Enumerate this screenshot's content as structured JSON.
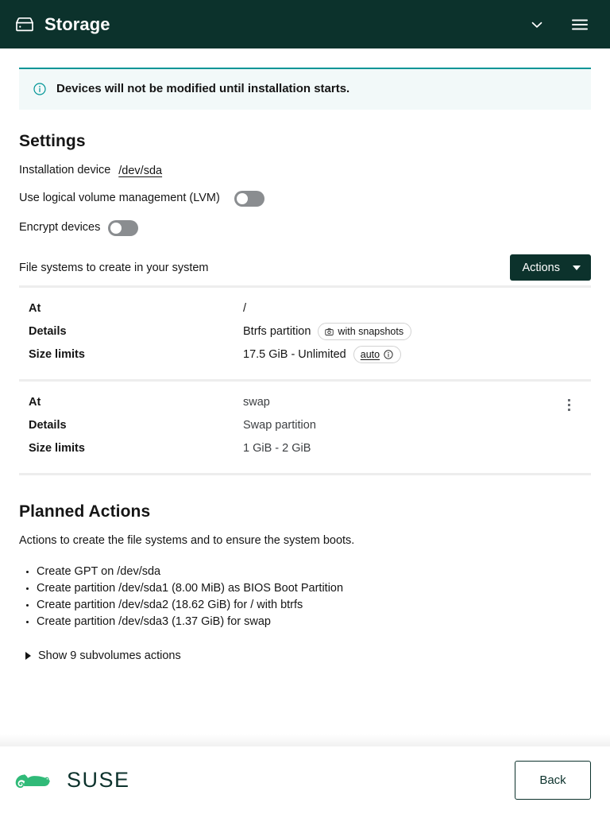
{
  "header": {
    "title": "Storage",
    "storage_icon": "hard-drive-icon",
    "collapse_icon": "chevron-down-icon",
    "menu_icon": "hamburger-menu-icon",
    "bg_color": "#0c322c"
  },
  "alert": {
    "icon": "info-circle-icon",
    "text": "Devices will not be modified until installation starts.",
    "accent_color": "#009596",
    "bg_color": "#f2f9f9"
  },
  "settings": {
    "title": "Settings",
    "installation_device": {
      "label": "Installation device",
      "value": "/dev/sda"
    },
    "lvm": {
      "label": "Use logical volume management (LVM)",
      "state": "off"
    },
    "encrypt": {
      "label": "Encrypt devices",
      "state": "off"
    }
  },
  "filesystems": {
    "caption": "File systems to create in your system",
    "actions_button": {
      "label": "Actions",
      "icon": "caret-down-icon"
    },
    "row_keys": {
      "at": "At",
      "details": "Details",
      "size_limits": "Size limits"
    },
    "rows": [
      {
        "at": "/",
        "details": "Btrfs partition",
        "details_chip": {
          "icon": "camera-snapshot-icon",
          "label": "with snapshots"
        },
        "size_limits": "17.5 GiB - Unlimited",
        "size_chip": {
          "label": "auto",
          "icon": "info-circle-icon"
        },
        "has_kebab": false
      },
      {
        "at": "swap",
        "details": "Swap partition",
        "details_chip": null,
        "size_limits": "1 GiB - 2 GiB",
        "size_chip": null,
        "has_kebab": true,
        "kebab_icon": "kebab-menu-icon"
      }
    ]
  },
  "planned_actions": {
    "title": "Planned Actions",
    "subtitle": "Actions to create the file systems and to ensure the system boots.",
    "items": [
      "Create GPT on /dev/sda",
      "Create partition /dev/sda1 (8.00 MiB) as BIOS Boot Partition",
      "Create partition /dev/sda2 (18.62 GiB) for / with btrfs",
      "Create partition /dev/sda3 (1.37 GiB) for swap"
    ],
    "expander": {
      "icon": "chevron-right-icon",
      "label": "Show 9 subvolumes actions"
    }
  },
  "footer": {
    "logo_icon": "suse-chameleon-logo",
    "logo_text": "SUSE",
    "logo_color": "#30ba78",
    "back_button": "Back"
  }
}
